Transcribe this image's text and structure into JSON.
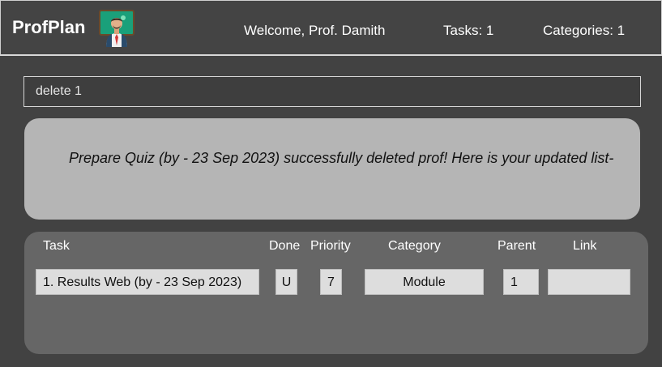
{
  "header": {
    "app_title": "ProfPlan",
    "welcome": "Welcome, Prof. Damith",
    "tasks_count": "Tasks: 1",
    "categories_count": "Categories: 1"
  },
  "command": {
    "value": "delete 1"
  },
  "result": {
    "message": "Prepare Quiz (by - 23 Sep 2023) successfully deleted prof! Here is your updated list-"
  },
  "task_list": {
    "columns": {
      "task": "Task",
      "done": "Done",
      "priority": "Priority",
      "category": "Category",
      "parent": "Parent",
      "link": "Link"
    },
    "rows": [
      {
        "task": "1. Results Web (by - 23 Sep 2023)",
        "done": "U",
        "priority": "7",
        "category": "Module",
        "parent": "1",
        "link": ""
      }
    ]
  },
  "colors": {
    "background": "#424242",
    "result_bg": "#b5b5b5",
    "list_bg": "#666666",
    "cell_bg": "#dddddd"
  },
  "icons": {
    "avatar": "teacher-at-board-icon"
  }
}
